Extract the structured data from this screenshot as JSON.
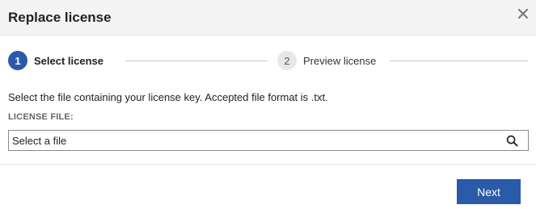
{
  "dialog": {
    "title": "Replace license",
    "close_icon": "close-icon"
  },
  "stepper": {
    "steps": [
      {
        "number": "1",
        "label": "Select license",
        "state": "active"
      },
      {
        "number": "2",
        "label": "Preview license",
        "state": "inactive"
      }
    ]
  },
  "body": {
    "description": "Select the file containing your license key. Accepted file format is .txt.",
    "field_label": "LICENSE FILE:",
    "file_input_value": "Select a file",
    "search_icon": "search-icon"
  },
  "footer": {
    "next_label": "Next"
  },
  "colors": {
    "accent": "#2a5aa8",
    "header_bg": "#f4f4f4",
    "inactive_step_bg": "#e8e8e8"
  }
}
